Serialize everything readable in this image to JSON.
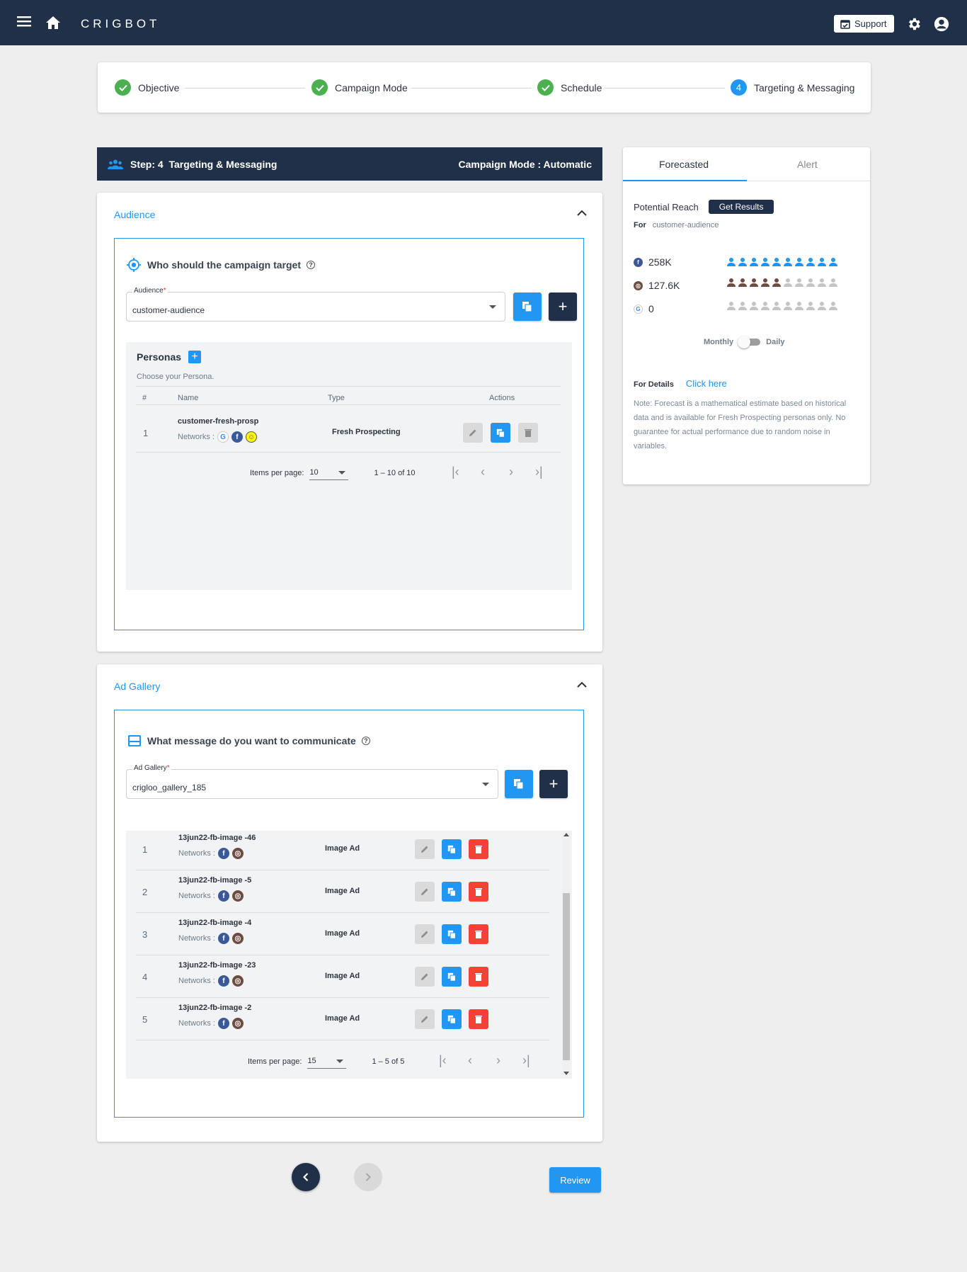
{
  "app": {
    "brand": "CRIGBOT",
    "support_label": "Support"
  },
  "stepper": {
    "steps": [
      {
        "label": "Objective",
        "status": "done"
      },
      {
        "label": "Campaign Mode",
        "status": "done"
      },
      {
        "label": "Schedule",
        "status": "done"
      },
      {
        "label": "Targeting & Messaging",
        "status": "active",
        "number": "4"
      }
    ]
  },
  "step_header": {
    "title": "Step: 4  Targeting & Messaging",
    "mode": "Campaign Mode : Automatic"
  },
  "audience": {
    "title": "Audience",
    "question": "Who should the campaign target",
    "field_label": "Audience",
    "field_value": "customer-audience",
    "personas": {
      "title": "Personas",
      "hint": "Choose your Persona.",
      "columns": [
        "#",
        "Name",
        "Type",
        "Actions"
      ],
      "rows": [
        {
          "num": "1",
          "name": "customer-fresh-prosp",
          "networks_label": "Networks :",
          "networks": [
            "google",
            "facebook",
            "snapchat"
          ],
          "type": "Fresh Prospecting"
        }
      ],
      "items_per_page_label": "Items per page:",
      "items_per_page": "10",
      "range": "1 – 10 of 10"
    }
  },
  "ad_gallery": {
    "title": "Ad Gallery",
    "question": "What message do you want to communicate",
    "field_label": "Ad Gallery",
    "field_value": "crigloo_gallery_185",
    "rows": [
      {
        "num": "1",
        "name": "13jun22-fb-image -46",
        "networks_label": "Networks :",
        "networks": [
          "facebook",
          "instagram"
        ],
        "type": "Image Ad"
      },
      {
        "num": "2",
        "name": "13jun22-fb-image -5",
        "networks_label": "Networks :",
        "networks": [
          "facebook",
          "instagram"
        ],
        "type": "Image Ad"
      },
      {
        "num": "3",
        "name": "13jun22-fb-image -4",
        "networks_label": "Networks :",
        "networks": [
          "facebook",
          "instagram"
        ],
        "type": "Image Ad"
      },
      {
        "num": "4",
        "name": "13jun22-fb-image -23",
        "networks_label": "Networks :",
        "networks": [
          "facebook",
          "instagram"
        ],
        "type": "Image Ad"
      },
      {
        "num": "5",
        "name": "13jun22-fb-image -2",
        "networks_label": "Networks :",
        "networks": [
          "facebook",
          "instagram"
        ],
        "type": "Image Ad"
      }
    ],
    "items_per_page_label": "Items per page:",
    "items_per_page": "15",
    "range": "1 – 5 of 5"
  },
  "forecast": {
    "tabs": [
      "Forecasted",
      "Alert"
    ],
    "active_tab": "Forecasted",
    "potential_reach_label": "Potential Reach",
    "get_results_label": "Get Results",
    "for_label": "For",
    "for_value": "customer-audience",
    "reach": [
      {
        "network": "facebook",
        "value": "258K",
        "filled_of_10": 10,
        "color": "#2196f3"
      },
      {
        "network": "instagram",
        "value": "127.6K",
        "filled_of_10": 5,
        "color": "#6d4c41"
      },
      {
        "network": "google",
        "value": "0",
        "filled_of_10": 0,
        "color": "#bdbdbd"
      }
    ],
    "toggle_left": "Monthly",
    "toggle_right": "Daily",
    "details_label": "For Details",
    "details_link": "Click here",
    "note": "Note: Forecast is a mathematical estimate based on historical data and is available for Fresh Prospecting personas only. No guarantee for actual performance due to random noise in variables."
  },
  "footer": {
    "review_label": "Review"
  },
  "colors": {
    "navy": "#203048",
    "accent": "#2196f3",
    "success": "#4caf50",
    "danger": "#f44336"
  }
}
